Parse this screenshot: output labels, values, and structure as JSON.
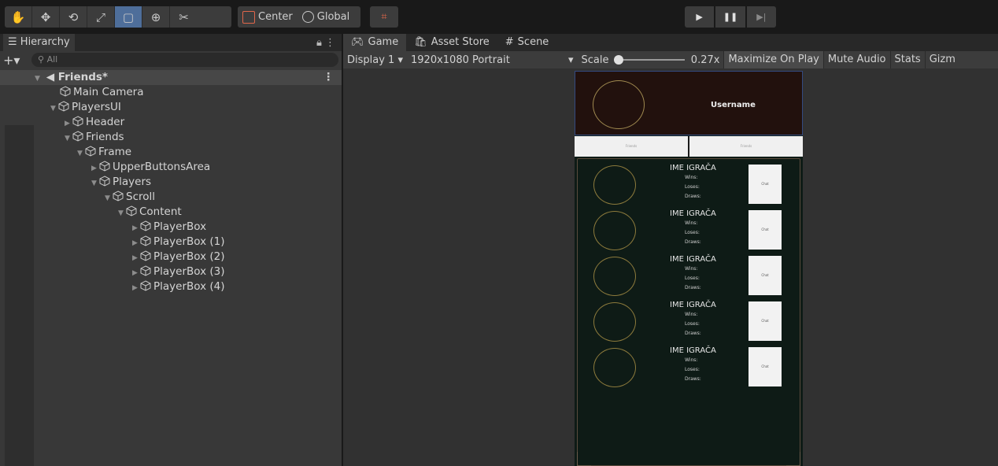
{
  "toolbar": {
    "tools": [
      "hand-icon",
      "move-icon",
      "rotate-icon",
      "scale-icon",
      "rect-icon",
      "transform-icon",
      "custom-tool-icon"
    ],
    "pivot_label": "Center",
    "space_label": "Global",
    "snap_icon": "grid-snap-icon",
    "play_icon": "play-icon",
    "pause_icon": "pause-icon",
    "step_icon": "step-icon"
  },
  "hierarchy": {
    "tab_label": "Hierarchy",
    "search_placeholder": "All",
    "scene_name": "Friends*",
    "items": [
      {
        "label": "Main Camera"
      },
      {
        "label": "PlayersUI"
      },
      {
        "label": "Header"
      },
      {
        "label": "Friends"
      },
      {
        "label": "Frame"
      },
      {
        "label": "UpperButtonsArea"
      },
      {
        "label": "Players"
      },
      {
        "label": "Scroll"
      },
      {
        "label": "Content"
      },
      {
        "label": "PlayerBox"
      },
      {
        "label": "PlayerBox (1)"
      },
      {
        "label": "PlayerBox (2)"
      },
      {
        "label": "PlayerBox (3)"
      },
      {
        "label": "PlayerBox (4)"
      }
    ]
  },
  "game_view": {
    "tabs": [
      {
        "label": "Game"
      },
      {
        "label": "Asset Store"
      },
      {
        "label": "Scene"
      }
    ],
    "display": "Display 1",
    "resolution": "1920x1080 Portrait",
    "scale_label": "Scale",
    "scale_value": "0.27x",
    "maximize": "Maximize On Play",
    "mute": "Mute Audio",
    "stats": "Stats",
    "gizmos": "Gizm"
  },
  "game_ui": {
    "username": "Username",
    "upper_buttons": [
      "Friends",
      "Friends"
    ],
    "players": [
      {
        "name": "IME IGRAČA",
        "wins": "Wins:",
        "loses": "Loses:",
        "draws": "Draws:",
        "chat": "Chat"
      },
      {
        "name": "IME IGRAČA",
        "wins": "Wins:",
        "loses": "Loses:",
        "draws": "Draws:",
        "chat": "Chat"
      },
      {
        "name": "IME IGRAČA",
        "wins": "Wins:",
        "loses": "Loses:",
        "draws": "Draws:",
        "chat": "Chat"
      },
      {
        "name": "IME IGRAČA",
        "wins": "Wins:",
        "loses": "Loses:",
        "draws": "Draws:",
        "chat": "Chat"
      },
      {
        "name": "IME IGRAČA",
        "wins": "Wins:",
        "loses": "Loses:",
        "draws": "Draws:",
        "chat": "Chat"
      }
    ]
  }
}
